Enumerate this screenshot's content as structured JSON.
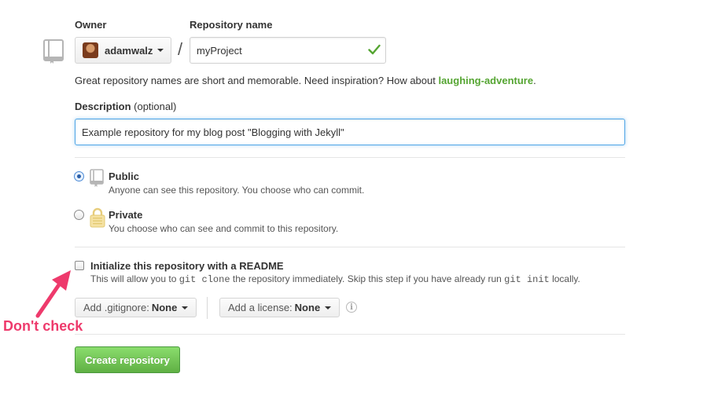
{
  "owner": {
    "label": "Owner",
    "value": "adamwalz"
  },
  "repo_name": {
    "label": "Repository name",
    "value": "myProject",
    "separator": "/"
  },
  "hint": {
    "prefix": "Great repository names are short and memorable. Need inspiration? How about ",
    "suggestion": "laughing-adventure",
    "suffix": "."
  },
  "description": {
    "label": "Description",
    "optional": "(optional)",
    "value": "Example repository for my blog post \"Blogging with Jekyll\""
  },
  "visibility": {
    "public": {
      "title": "Public",
      "note": "Anyone can see this repository. You choose who can commit.",
      "selected": true
    },
    "private": {
      "title": "Private",
      "note": "You choose who can see and commit to this repository.",
      "selected": false
    }
  },
  "readme": {
    "label": "Initialize this repository with a README",
    "note_1": "This will allow you to ",
    "code_1": "git clone",
    "note_2": " the repository immediately. Skip this step if you have already run ",
    "code_2": "git init",
    "note_3": " locally.",
    "checked": false
  },
  "gitignore": {
    "label": "Add .gitignore:",
    "value": "None"
  },
  "license": {
    "label": "Add a license:",
    "value": "None"
  },
  "info_icon": "info-icon",
  "create_button": "Create repository",
  "annotation": {
    "text": "Don't check",
    "color": "#ee3a6c"
  },
  "colors": {
    "accent_green": "#55a532",
    "button_green": "#60b044",
    "focus_blue": "#51a7e8"
  }
}
